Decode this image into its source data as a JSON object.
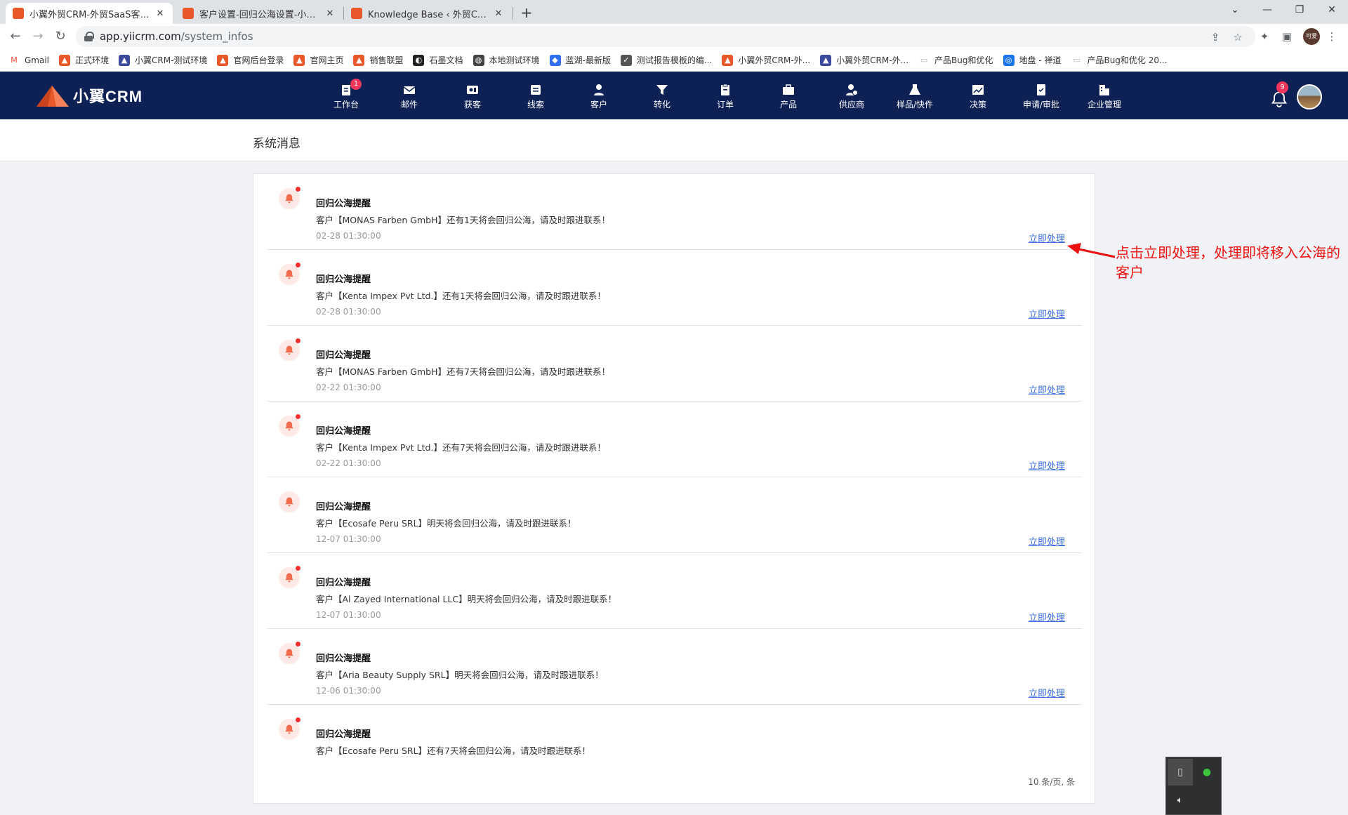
{
  "browser": {
    "tabs": [
      {
        "title": "小翼外贸CRM-外贸SaaS客户管理",
        "active": true
      },
      {
        "title": "客户设置-回归公海设置-小翼外贸",
        "active": false
      },
      {
        "title": "Knowledge Base ‹ 外贸CRM-外",
        "active": false
      }
    ],
    "url_host": "app.yiicrm.com",
    "url_path": "/system_infos",
    "profile_label": "可爱",
    "bookmarks": [
      {
        "label": "Gmail",
        "icon": "gmail-icon",
        "color": "#ea4335"
      },
      {
        "label": "正式环境",
        "icon": "yiicrm-icon",
        "color": "#e8582a"
      },
      {
        "label": "小翼CRM-测试环境",
        "icon": "triangle-icon",
        "color": "#3b4a9a"
      },
      {
        "label": "官网后台登录",
        "icon": "yiicrm-icon",
        "color": "#e8582a"
      },
      {
        "label": "官网主页",
        "icon": "yiicrm-icon",
        "color": "#e8582a"
      },
      {
        "label": "销售联盟",
        "icon": "yiicrm-icon",
        "color": "#e8582a"
      },
      {
        "label": "石墨文档",
        "icon": "shimo-icon",
        "color": "#222222"
      },
      {
        "label": "本地测试环境",
        "icon": "globe-icon",
        "color": "#444444"
      },
      {
        "label": "蓝湖-最新版",
        "icon": "lanhu-icon",
        "color": "#3070f0"
      },
      {
        "label": "测试报告模板的编...",
        "icon": "yuque-icon",
        "color": "#555555"
      },
      {
        "label": "小翼外贸CRM-外...",
        "icon": "yiicrm-icon",
        "color": "#e8582a"
      },
      {
        "label": "小翼外贸CRM-外...",
        "icon": "triangle-icon",
        "color": "#3b4a9a"
      },
      {
        "label": "产品Bug和优化",
        "icon": "page-icon",
        "color": "#bbbbbb"
      },
      {
        "label": "地盘 - 禅道",
        "icon": "zentao-icon",
        "color": "#1a73e8"
      },
      {
        "label": "产品Bug和优化 20...",
        "icon": "page-icon",
        "color": "#bbbbbb"
      }
    ]
  },
  "app": {
    "logo_text": "小翼CRM",
    "nav": [
      {
        "label": "工作台",
        "icon": "workbench-icon",
        "badge": "1"
      },
      {
        "label": "邮件",
        "icon": "mail-icon",
        "badge": ""
      },
      {
        "label": "获客",
        "icon": "acquire-icon",
        "badge": ""
      },
      {
        "label": "线索",
        "icon": "leads-icon",
        "badge": ""
      },
      {
        "label": "客户",
        "icon": "customer-icon",
        "badge": ""
      },
      {
        "label": "转化",
        "icon": "funnel-icon",
        "badge": ""
      },
      {
        "label": "订单",
        "icon": "order-icon",
        "badge": ""
      },
      {
        "label": "产品",
        "icon": "product-icon",
        "badge": ""
      },
      {
        "label": "供应商",
        "icon": "supplier-icon",
        "badge": ""
      },
      {
        "label": "样品/快件",
        "icon": "sample-icon",
        "badge": ""
      },
      {
        "label": "决策",
        "icon": "decision-icon",
        "badge": ""
      },
      {
        "label": "申请/审批",
        "icon": "approval-icon",
        "badge": ""
      },
      {
        "label": "企业管理",
        "icon": "company-icon",
        "badge": ""
      }
    ],
    "notification_badge": "9",
    "brand_color": "#0e2155",
    "accent_color": "#e8582a"
  },
  "page": {
    "title": "系统消息",
    "action_color": "#3b6fe0",
    "messages": [
      {
        "title": "回归公海提醒",
        "text": "客户【MONAS Farben GmbH】还有1天将会回归公海，请及时跟进联系！",
        "time": "02-28 01:30:00",
        "action": "立即处理",
        "unread": true
      },
      {
        "title": "回归公海提醒",
        "text": "客户【Kenta Impex Pvt Ltd.】还有1天将会回归公海，请及时跟进联系！",
        "time": "02-28 01:30:00",
        "action": "立即处理",
        "unread": true
      },
      {
        "title": "回归公海提醒",
        "text": "客户【MONAS Farben GmbH】还有7天将会回归公海，请及时跟进联系！",
        "time": "02-22 01:30:00",
        "action": "立即处理",
        "unread": true
      },
      {
        "title": "回归公海提醒",
        "text": "客户【Kenta Impex Pvt Ltd.】还有7天将会回归公海，请及时跟进联系！",
        "time": "02-22 01:30:00",
        "action": "立即处理",
        "unread": true
      },
      {
        "title": "回归公海提醒",
        "text": "客户【Ecosafe Peru SRL】明天将会回归公海，请及时跟进联系！",
        "time": "12-07 01:30:00",
        "action": "立即处理",
        "unread": false
      },
      {
        "title": "回归公海提醒",
        "text": "客户【Al Zayed International LLC】明天将会回归公海，请及时跟进联系！",
        "time": "12-07 01:30:00",
        "action": "立即处理",
        "unread": true
      },
      {
        "title": "回归公海提醒",
        "text": "客户【Aria Beauty Supply SRL】明天将会回归公海，请及时跟进联系！",
        "time": "12-06 01:30:00",
        "action": "立即处理",
        "unread": true
      },
      {
        "title": "回归公海提醒",
        "text": "客户【Ecosafe Peru SRL】还有7天将会回归公海，请及时跟进联系！",
        "time": "",
        "action": "",
        "unread": true
      }
    ],
    "pager_text": "10 条/页,  条"
  },
  "annotation": {
    "text": "点击立即处理，处理即将移入公海的客户",
    "color": "#ee1111"
  }
}
